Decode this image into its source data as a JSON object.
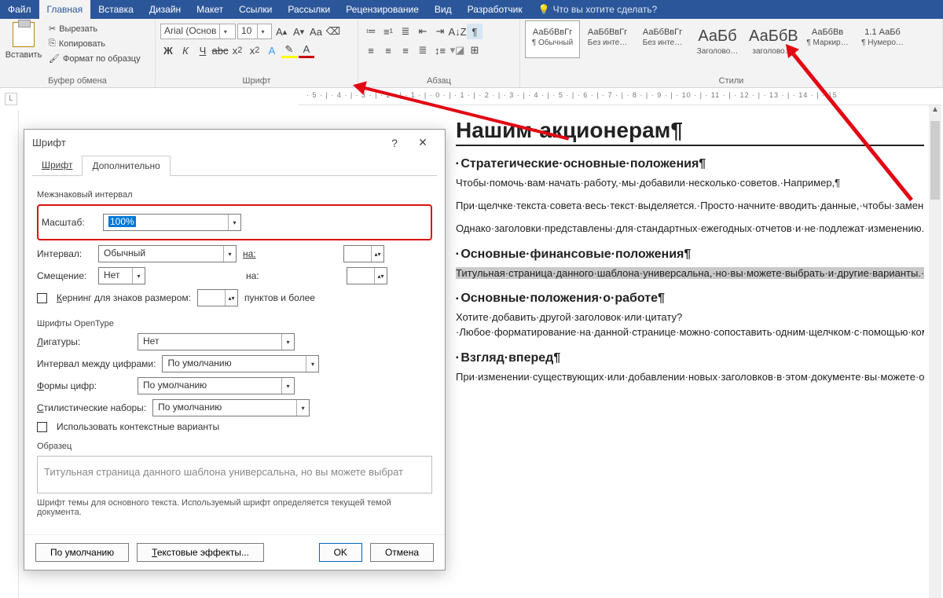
{
  "menubar": {
    "file": "Файл",
    "tabs": [
      "Главная",
      "Вставка",
      "Дизайн",
      "Макет",
      "Ссылки",
      "Рассылки",
      "Рецензирование",
      "Вид",
      "Разработчик"
    ],
    "tell": "Что вы хотите сделать?"
  },
  "ribbon": {
    "clipboard": {
      "paste": "Вставить",
      "cut": "Вырезать",
      "copy": "Копировать",
      "painter": "Формат по образцу",
      "title": "Буфер обмена"
    },
    "font": {
      "family": "Arial (Основ",
      "size": "10",
      "title": "Шрифт"
    },
    "paragraph": {
      "title": "Абзац"
    },
    "styles": {
      "title": "Стили",
      "items": [
        {
          "preview": "АаБбВвГг",
          "name": "¶ Обычный",
          "sel": true
        },
        {
          "preview": "АаБбВвГг",
          "name": "Без инте…"
        },
        {
          "preview": "АаБбВвГг",
          "name": "Без инте…"
        },
        {
          "preview": "АаБб",
          "name": "Заголово…",
          "big": true
        },
        {
          "preview": "АаБбВ",
          "name": "заголово…",
          "big": true
        },
        {
          "preview": "АаБбВв",
          "name": "¶ Маркир…"
        },
        {
          "preview": "1.1 АаБб",
          "name": "¶ Нумеро…"
        }
      ]
    }
  },
  "ruler": "· 5 · | · 4 · | · 3 · | · 2 · | · 1 · | · 0 · | · 1 · | · 2 · | · 3 · | · 4 · | · 5 · | · 6 · | · 7 · | · 8 · | · 9 · | · 10 · | · 11 · | · 12 · | · 13 · | · 14 · | · 15",
  "doc": {
    "h1": "Нашим·акционерам¶",
    "s1": {
      "h": "Стратегические·основные·положения¶",
      "p1": "Чтобы·помочь·вам·начать·работу,·мы·добавили·несколько·советов.·Например,¶",
      "p2": "При·щелчке·текста·совета·весь·текст·выделяется.·Просто·начните·вводить·данные,·чтобы·заменить·его·на·другой·текст.¶",
      "p3": "Однако·заголовки·представлены·для·стандартных·ежегодных·отчетов·и·не·подлежат·изменению.·¶"
    },
    "s2": {
      "h": "Основные·финансовые·положения¶",
      "p1": "Титульная·страница·данного·шаблона·универсальна,·но·вы·можете·выбрать·и·другие·варианты.·На·вкладке·«Вставка»·выберите·команду·«Титульная·страница»,·чтобы·открыть·коллекцию·доступных·вариантов.·Если·вы·уже·добавили·текст·на·эту·страницу,·он·перенесется·на·другую·выбранную·титульную·страницу.·¶"
    },
    "s3": {
      "h": "Основные·положения·о·работе¶",
      "p1": "Хотите·добавить·другой·заголовок·или·цитату?·Любое·форматирование·на·данной·странице·можно·сопоставить·одним·щелчком·с·помощью·команды·«Стили».·Найдите·коллекцию·стилей·для·данного·шаблона·на·вкладке·«Главная»·ленты.·¶"
    },
    "s4": {
      "h": "Взгляд·вперед¶",
      "p1": "При·изменении·существующих·или·добавлении·новых·заголовков·в·этом·документе·вы·можете·одним·щелчком·обновить·оглавление.·Чтобы·просмотреть·новые·заголовки,·щелкните·в·любой·области·оглавления,·а·затем·выберите·пункт·«Обновить·таблицу».¶"
    }
  },
  "dialog": {
    "title": "Шрифт",
    "tabs": {
      "font": "Шрифт",
      "advanced": "Дополнительно"
    },
    "spacing": {
      "section": "Межзнаковый интервал",
      "scale_l": "Масштаб:",
      "scale_v": "100%",
      "spacing_l": "Интервал:",
      "spacing_v": "Обычный",
      "by_l": "на:",
      "position_l": "Смещение:",
      "position_v": "Нет",
      "by2_l": "на:",
      "kerning_l": "Кернинг для знаков размером:",
      "kerning_after": "пунктов и более"
    },
    "opentype": {
      "section": "Шрифты OpenType",
      "lig_l": "Лигатуры:",
      "lig_v": "Нет",
      "numsp_l": "Интервал между цифрами:",
      "numsp_v": "По умолчанию",
      "numf_l": "Формы цифр:",
      "numf_v": "По умолчанию",
      "styset_l": "Стилистические наборы:",
      "styset_v": "По умолчанию",
      "context_l": "Использовать контекстные варианты"
    },
    "preview": {
      "section": "Образец",
      "text": "Титульная страница данного шаблона универсальна, но вы можете выбрат",
      "note": "Шрифт темы для основного текста. Используемый шрифт определяется текущей темой документа."
    },
    "footer": {
      "default": "По умолчанию",
      "effects": "Текстовые эффекты...",
      "ok": "OK",
      "cancel": "Отмена"
    }
  }
}
